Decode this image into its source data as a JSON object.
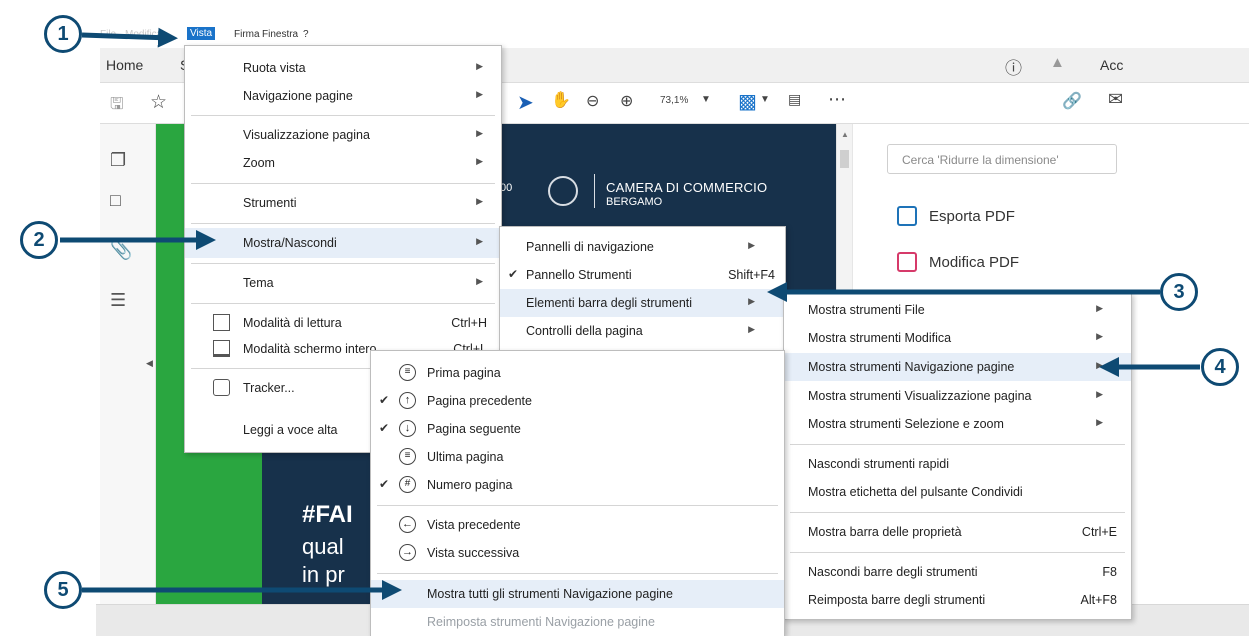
{
  "menubar": {
    "items": [
      "File",
      "Modifica",
      "Vista",
      "Firma",
      "Finestra",
      "?"
    ],
    "active": "Vista"
  },
  "tabs": {
    "home": "Home"
  },
  "toolbar": {
    "zoom": "73,1%"
  },
  "header_right": {
    "account_label": "Acc"
  },
  "document": {
    "org_name_line1": "CAMERA DI COMMERCIO",
    "org_name_line2": "BERGAMO",
    "hashtag": "#FAI",
    "line2": "qual",
    "line3": "in pr"
  },
  "right_panel": {
    "search_placeholder": "Cerca 'Ridurre la dimensione'",
    "items": [
      "Esporta PDF",
      "Modifica PDF"
    ]
  },
  "vista_menu": {
    "items": [
      {
        "label": "Ruota vista"
      },
      {
        "label": "Navigazione pagine"
      },
      {
        "label": "Visualizzazione pagina"
      },
      {
        "label": "Zoom"
      },
      {
        "label": "Strumenti"
      },
      {
        "label": "Mostra/Nascondi"
      },
      {
        "label": "Tema"
      },
      {
        "label": "Modalità di lettura",
        "shortcut": "Ctrl+H"
      },
      {
        "label": "Modalità schermo intero",
        "shortcut": "Ctrl+L"
      },
      {
        "label": "Tracker..."
      },
      {
        "label": "Leggi a voce alta"
      }
    ]
  },
  "mostra_menu": {
    "items": [
      {
        "label": "Pannelli di navigazione"
      },
      {
        "label": "Pannello Strumenti",
        "shortcut": "Shift+F4",
        "checked": true
      },
      {
        "label": "Elementi barra degli strumenti"
      },
      {
        "label": "Controlli della pagina"
      }
    ]
  },
  "elementi_menu": {
    "items": [
      {
        "label": "Mostra strumenti File"
      },
      {
        "label": "Mostra strumenti Modifica"
      },
      {
        "label": "Mostra strumenti Navigazione pagine"
      },
      {
        "label": "Mostra strumenti Visualizzazione pagina"
      },
      {
        "label": "Mostra strumenti Selezione e zoom"
      },
      {
        "label": "Nascondi strumenti rapidi"
      },
      {
        "label": "Mostra etichetta del pulsante Condividi"
      },
      {
        "label": "Mostra barra delle proprietà",
        "shortcut": "Ctrl+E"
      },
      {
        "label": "Nascondi barre degli strumenti",
        "shortcut": "F8"
      },
      {
        "label": "Reimposta barre degli strumenti",
        "shortcut": "Alt+F8"
      }
    ]
  },
  "nav_menu": {
    "items": [
      {
        "label": "Prima pagina",
        "checked": false
      },
      {
        "label": "Pagina precedente",
        "checked": true
      },
      {
        "label": "Pagina seguente",
        "checked": true
      },
      {
        "label": "Ultima pagina",
        "checked": false
      },
      {
        "label": "Numero pagina",
        "checked": true
      },
      {
        "label": "Vista precedente",
        "checked": false
      },
      {
        "label": "Vista successiva",
        "checked": false
      },
      {
        "label": "Mostra tutti gli strumenti Navigazione pagine"
      },
      {
        "label": "Reimposta strumenti Navigazione pagine",
        "disabled": true
      }
    ]
  },
  "annotations": [
    "1",
    "2",
    "3",
    "4",
    "5"
  ],
  "colors": {
    "accent": "#1a73c9",
    "annotation": "#0e4a73",
    "doc_navy": "#17314b",
    "doc_green": "#2aa640",
    "highlight": "#e6eef8"
  }
}
